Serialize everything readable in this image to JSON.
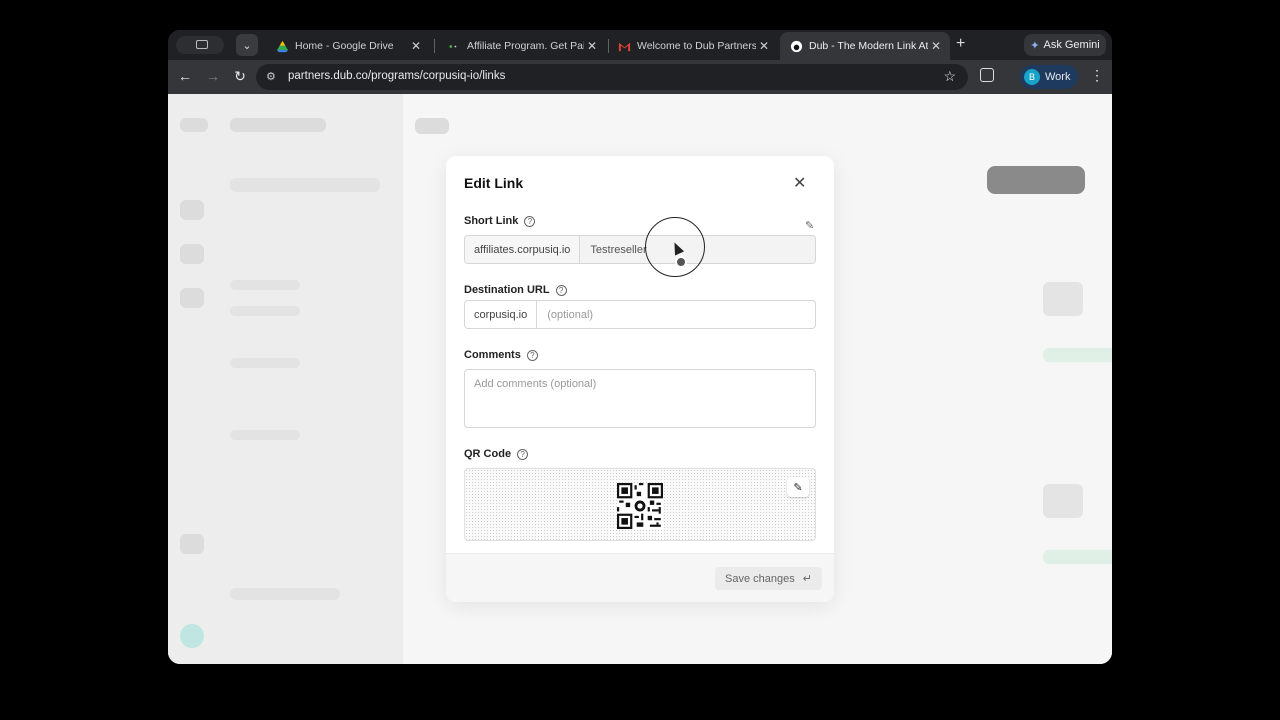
{
  "browser": {
    "tabs": [
      {
        "title": "Home - Google Drive",
        "icon": "google-drive-icon",
        "active": false
      },
      {
        "title": "Affiliate Program. Get Paid",
        "icon": "affiliate-icon",
        "active": false
      },
      {
        "title": "Welcome to Dub Partners!",
        "icon": "gmail-icon",
        "active": false
      },
      {
        "title": "Dub - The Modern Link Attr",
        "icon": "dub-icon",
        "active": true
      }
    ],
    "new_tab_glyph": "+",
    "gemini_label": "Ask Gemini",
    "url": "partners.dub.co/programs/corpusiq-io/links",
    "profile_initial": "B",
    "profile_label": "Work"
  },
  "modal": {
    "title": "Edit Link",
    "short_link": {
      "label": "Short Link",
      "domain": "affiliates.corpusiq.io",
      "key": "Testreseller"
    },
    "destination": {
      "label": "Destination URL",
      "domain": "corpusiq.io",
      "placeholder": "(optional)"
    },
    "comments": {
      "label": "Comments",
      "placeholder": "Add comments (optional)"
    },
    "qr": {
      "label": "QR Code"
    },
    "save_label": "Save changes",
    "save_key_hint": "↵"
  },
  "colors": {
    "browser_bg": "#202124",
    "toolbar_bg": "#35363a",
    "profile_bg": "#1e3a5f",
    "profile_avatar": "#1aa3c9"
  }
}
